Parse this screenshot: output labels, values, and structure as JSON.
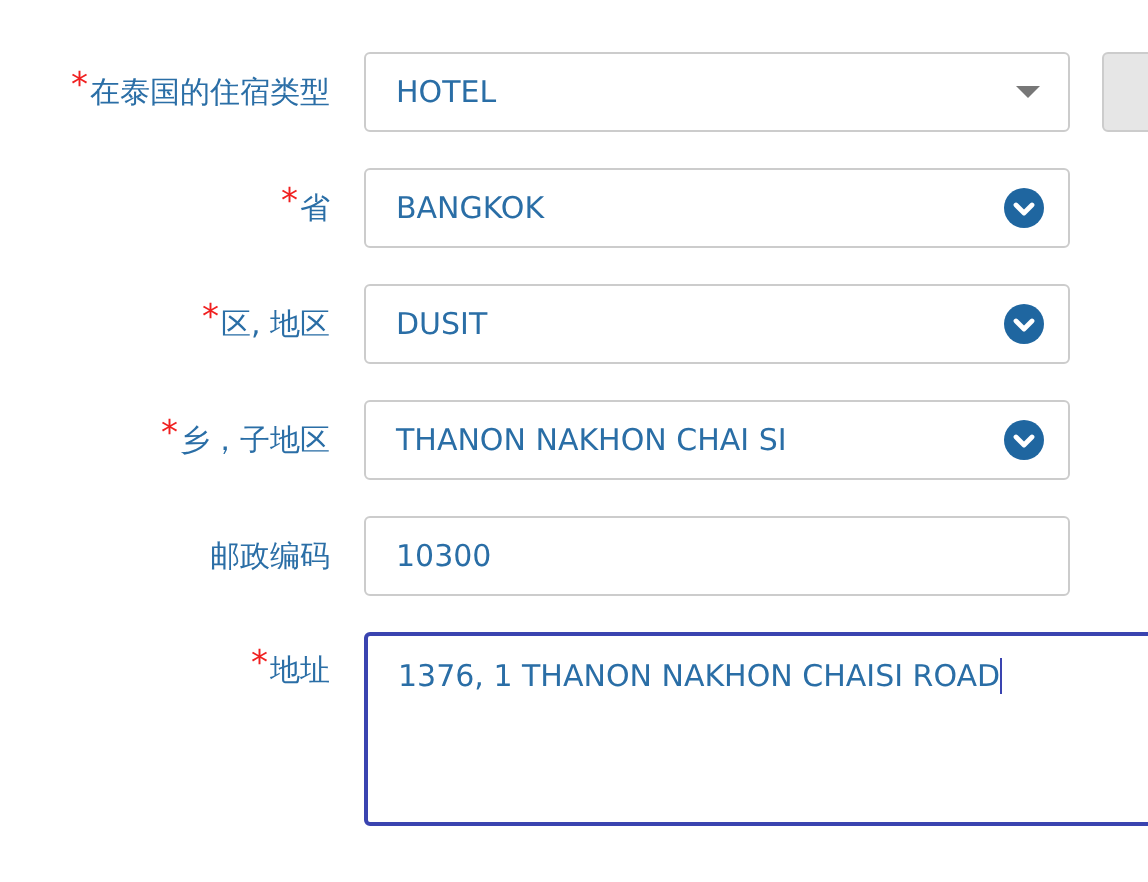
{
  "fields": [
    {
      "marker": "*",
      "label": "在泰国的住宿类型",
      "kind": "dropdown",
      "value": "HOTEL",
      "side_button": true
    },
    {
      "marker": "*",
      "label": "省",
      "kind": "select",
      "value": "BANGKOK"
    },
    {
      "marker": "*",
      "label": "区, 地区",
      "kind": "select",
      "value": "DUSIT"
    },
    {
      "marker": "*",
      "label": "乡，子地区",
      "kind": "select",
      "value": "THANON NAKHON CHAI SI"
    },
    {
      "label": "邮政编码",
      "kind": "text",
      "value": "10300"
    },
    {
      "marker": "*",
      "label": "地址",
      "kind": "textarea",
      "value": "1376, 1 THANON NAKHON CHAISI ROAD",
      "focused": true
    }
  ]
}
